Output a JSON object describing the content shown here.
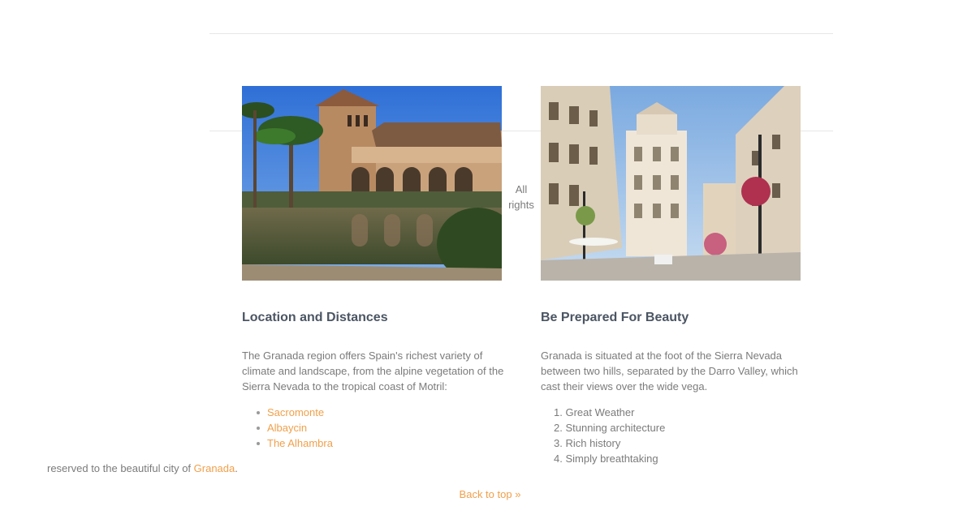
{
  "center_note": [
    "All",
    "rights"
  ],
  "left_column": {
    "image_alt": "Alhambra palace with reflecting pool",
    "heading": "Location and Distances",
    "paragraph": "The Granada region offers Spain's richest variety of climate and landscape, from the alpine vegetation of the Sierra Nevada to the tropical coast of Motril:",
    "links": [
      "Sacromonte",
      "Albaycin",
      "The Alhambra"
    ]
  },
  "right_column": {
    "image_alt": "Granada city street with buildings",
    "heading": "Be Prepared For Beauty",
    "paragraph": "Granada is situated at the foot of the Sierra Nevada between two hills, separated by the Darro Valley, which cast their views over the wide vega.",
    "list": [
      "1. Great Weather",
      "2. Stunning architecture",
      "3. Rich history",
      "4. Simply breathtaking"
    ]
  },
  "footer": {
    "text_before": "reserved to the beautiful city of ",
    "link": "Granada",
    "text_after": "."
  },
  "back_to_top": "Back to top »",
  "colors": {
    "link": "#f0a04b",
    "heading": "#4b5563",
    "body_text": "#7b7b7b",
    "rule": "#e6e6e6"
  }
}
